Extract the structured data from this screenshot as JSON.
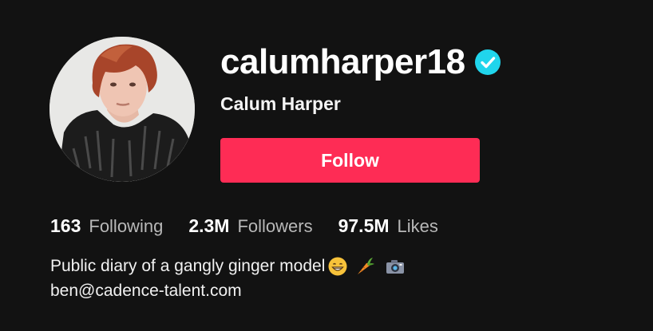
{
  "profile": {
    "username": "calumharper18",
    "display_name": "Calum Harper",
    "verified": true,
    "avatar": "profile-photo"
  },
  "actions": {
    "follow_label": "Follow"
  },
  "stats": [
    {
      "value": "163",
      "label": "Following"
    },
    {
      "value": "2.3M",
      "label": "Followers"
    },
    {
      "value": "97.5M",
      "label": "Likes"
    }
  ],
  "bio": {
    "line1": "Public diary of a gangly ginger model",
    "emojis": [
      "grinning-face-emoji",
      "carrot-emoji",
      "camera-emoji"
    ],
    "line2": "ben@cadence-talent.com"
  },
  "colors": {
    "background": "#121212",
    "follow_button": "#fe2c55",
    "verified_badge": "#20d5ec",
    "secondary_text": "#b8b8b8"
  }
}
